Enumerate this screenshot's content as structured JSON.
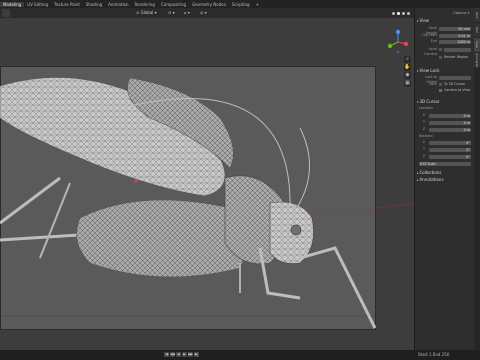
{
  "workspace_tabs": [
    {
      "label": "Modeling",
      "active": true
    },
    {
      "label": "UV Editing",
      "active": false
    },
    {
      "label": "Texture Paint",
      "active": false
    },
    {
      "label": "Shading",
      "active": false
    },
    {
      "label": "Animation",
      "active": false
    },
    {
      "label": "Rendering",
      "active": false
    },
    {
      "label": "Compositing",
      "active": false
    },
    {
      "label": "Geometry Nodes",
      "active": false
    },
    {
      "label": "Scripting",
      "active": false
    },
    {
      "label": "+",
      "active": false
    }
  ],
  "toolbar": {
    "global_label": "Global"
  },
  "npanel": {
    "options_label": "Options",
    "view_section": "View",
    "focal_length_label": "Focal Length",
    "focal_length_value": "50 mm",
    "clip_start_label": "Clip Start",
    "clip_start_value": "0.01 m",
    "clip_end_label": "End",
    "clip_end_value": "1000 m",
    "local_camera_label": "Local Camera",
    "render_region_label": "Render Region",
    "view_lock_section": "View Lock",
    "lock_to_object_label": "Lock to Object",
    "lock_label": "Lock",
    "to_3d_cursor_label": "To 3D Cursor",
    "camera_to_view_label": "Camera to View",
    "cursor_section": "3D Cursor",
    "location_label": "Location",
    "location": [
      {
        "axis": "X",
        "value": "0 m"
      },
      {
        "axis": "Y",
        "value": "0 m"
      },
      {
        "axis": "Z",
        "value": "0 m"
      }
    ],
    "rotation_label": "Rotation",
    "rotation": [
      {
        "axis": "X",
        "value": "0°"
      },
      {
        "axis": "Y",
        "value": "0°"
      },
      {
        "axis": "Z",
        "value": "0°"
      }
    ],
    "rotation_mode": "XYZ Euler",
    "collections_section": "Collections",
    "annotations_section": "Annotations"
  },
  "sidebar_tabs": [
    "Item",
    "Tool",
    "View",
    "Animation"
  ],
  "statusbar": {
    "right_text": "Start  1    End  250"
  },
  "colors": {
    "accent": "#4772b3",
    "axis_x": "#e84352",
    "axis_y": "#70b81a",
    "axis_z": "#4a8ef0"
  }
}
